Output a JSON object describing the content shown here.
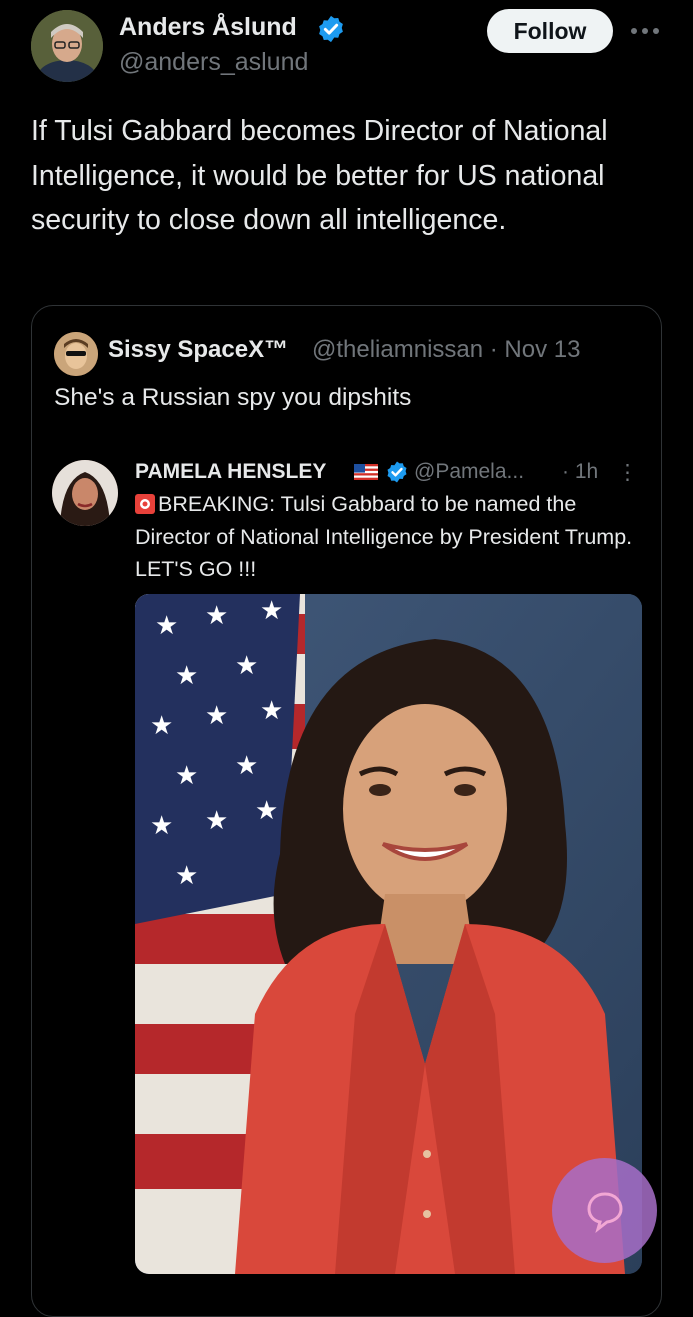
{
  "tweet": {
    "author_name": "Anders Åslund",
    "author_handle": "@anders_aslund",
    "follow_label": "Follow",
    "text": "If Tulsi Gabbard becomes Director of National Intelligence, it would be better for US national security to close down all intelligence."
  },
  "quote": {
    "name": "Sissy SpaceX™",
    "meta": "@theliamnissan · Nov 13",
    "text": "She's a Russian spy you dipshits",
    "inner": {
      "name": "PAMELA HENSLEY",
      "handle": "@Pamela...",
      "time": "· 1h",
      "text": "BREAKING: Tulsi Gabbard to be named the Director of National Intelligence by President Trump. LET'S GO !!!"
    }
  },
  "colors": {
    "background": "#000000",
    "text": "#e7e9ea",
    "muted": "#71767b",
    "verified": "#1d9bf0",
    "border": "#2f3336",
    "blazer": "#d9483b"
  },
  "icons": {
    "verified": "verified-badge-icon",
    "more": "more-horizontal-icon",
    "flag": "us-flag-emoji",
    "siren": "siren-emoji",
    "fab": "compose-fab-icon"
  }
}
